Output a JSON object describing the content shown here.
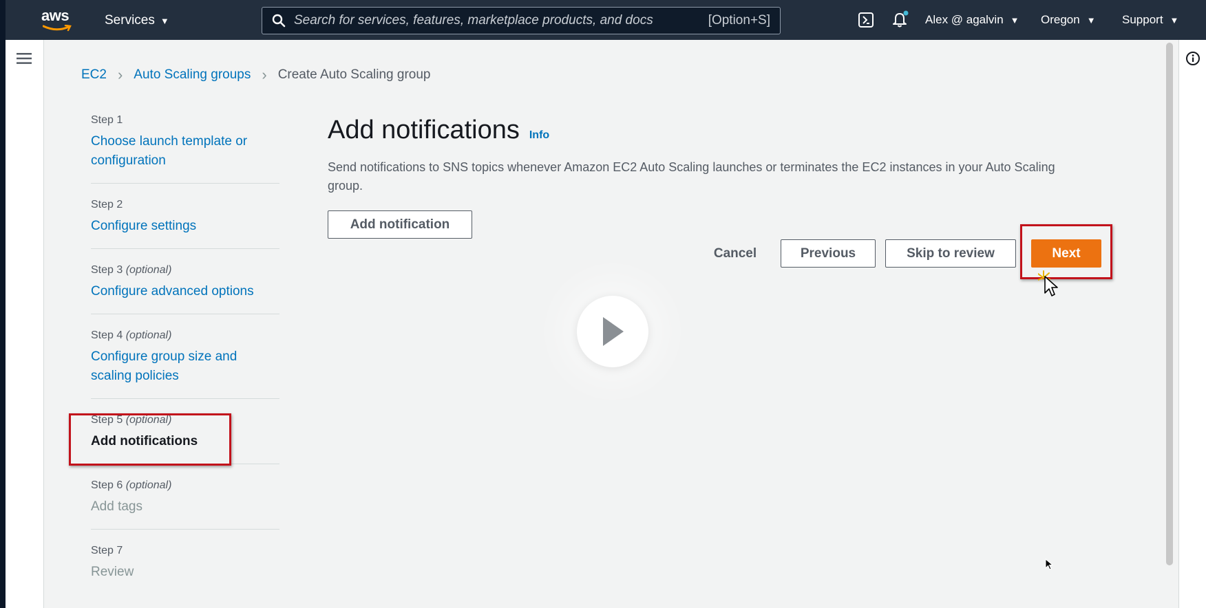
{
  "nav": {
    "logo": "aws",
    "services": "Services",
    "search_placeholder": "Search for services, features, marketplace products, and docs",
    "search_shortcut": "[Option+S]",
    "user": "Alex @ agalvin",
    "region": "Oregon",
    "support": "Support",
    "icons": [
      "cloudshell-icon",
      "bell-icon"
    ]
  },
  "breadcrumb": {
    "items": [
      "EC2",
      "Auto Scaling groups"
    ],
    "current": "Create Auto Scaling group"
  },
  "steps": [
    {
      "number": "Step 1",
      "optional": "",
      "label": "Choose launch template or configuration",
      "state": "link"
    },
    {
      "number": "Step 2",
      "optional": "",
      "label": "Configure settings",
      "state": "link"
    },
    {
      "number": "Step 3",
      "optional": "(optional)",
      "label": "Configure advanced options",
      "state": "link"
    },
    {
      "number": "Step 4",
      "optional": "(optional)",
      "label": "Configure group size and scaling policies",
      "state": "link"
    },
    {
      "number": "Step 5",
      "optional": "(optional)",
      "label": "Add notifications",
      "state": "active"
    },
    {
      "number": "Step 6",
      "optional": "(optional)",
      "label": "Add tags",
      "state": "disabled"
    },
    {
      "number": "Step 7",
      "optional": "",
      "label": "Review",
      "state": "disabled"
    }
  ],
  "main": {
    "title": "Add notifications",
    "info": "Info",
    "description": "Send notifications to SNS topics whenever Amazon EC2 Auto Scaling launches or terminates the EC2 instances in your Auto Scaling group.",
    "add_notification": "Add notification",
    "cancel": "Cancel",
    "previous": "Previous",
    "skip": "Skip to review",
    "next": "Next"
  },
  "colors": {
    "nav_bg": "#232f3e",
    "link": "#0073bb",
    "primary": "#ec7211",
    "highlight": "#c2121b"
  }
}
